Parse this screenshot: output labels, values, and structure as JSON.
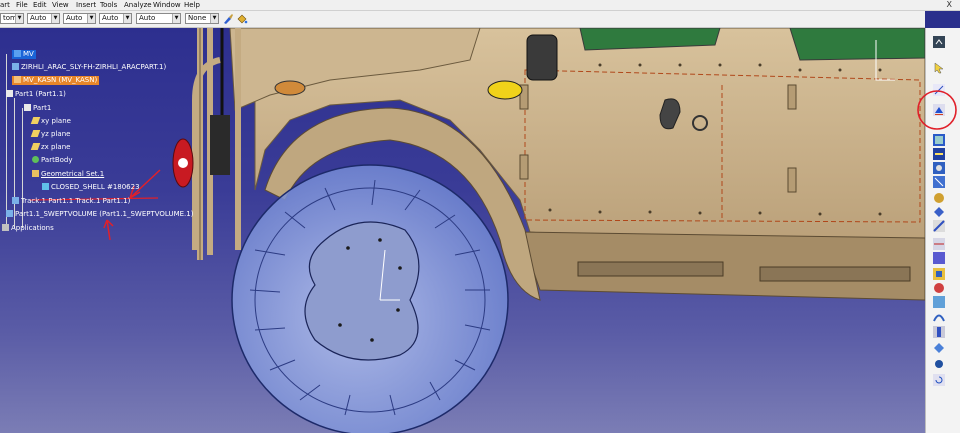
{
  "menubar": {
    "items": [
      "art",
      "File",
      "Edit",
      "View",
      "Insert",
      "Tools",
      "Analyze",
      "Window",
      "Help"
    ],
    "close_symbol": "X"
  },
  "toolbar": {
    "combos": [
      {
        "value": "tomet"
      },
      {
        "value": "Auto"
      },
      {
        "value": "Auto"
      },
      {
        "value": "Auto"
      },
      {
        "value": "Auto"
      },
      {
        "value": "None"
      }
    ],
    "icons": [
      "brush-icon",
      "paint-bucket-icon"
    ]
  },
  "tree": {
    "nodes": [
      {
        "label": "MV",
        "style": "hl",
        "icon": "product-icon"
      },
      {
        "label": "ZIRHLI_ARAC_SLY-FH-ZIRHLI_ARACPART.1)",
        "style": "",
        "icon": "product-icon"
      },
      {
        "label": "MV_KASN (MV_KASN)",
        "style": "orange",
        "icon": "product-icon"
      },
      {
        "label": "Part1 (Part1.1)",
        "style": "",
        "icon": "part-icon"
      },
      {
        "label": "Part1",
        "style": "",
        "icon": "part-icon"
      },
      {
        "label": "xy plane",
        "style": "",
        "icon": "plane-icon"
      },
      {
        "label": "yz plane",
        "style": "",
        "icon": "plane-icon"
      },
      {
        "label": "zx plane",
        "style": "",
        "icon": "plane-icon"
      },
      {
        "label": "PartBody",
        "style": "",
        "icon": "body-icon"
      },
      {
        "label": "Geometrical Set.1",
        "style": "",
        "icon": "geoset-icon"
      },
      {
        "label": "CLOSED_SHELL #180623",
        "style": "",
        "icon": "shell-icon"
      },
      {
        "label": "Track.1 Part1.1 Track.1 Part1.1)",
        "style": "",
        "icon": "product-icon"
      },
      {
        "label": "Part1.1_SWEPTVOLUME (Part1.1_SWEPTVOLUME.1)",
        "style": "",
        "icon": "product-icon"
      },
      {
        "label": "Applications",
        "style": "",
        "icon": "applications-icon"
      }
    ]
  },
  "right_toolbar": {
    "icons": [
      "chevron-up-icon",
      "cursor-icon",
      "sketch-icon",
      "swept-volume-icon",
      "catalog-icon",
      "measure-icon",
      "assembly-icon",
      "constraint-icon",
      "snap-icon",
      "clash-icon",
      "section-icon",
      "distance-icon",
      "publish-icon",
      "analysis-icon",
      "sticky-icon",
      "shell-icon",
      "sweep-icon",
      "tools-icon",
      "manipulate-icon",
      "explode-icon",
      "update-icon"
    ]
  },
  "colors": {
    "viewport_top": "#2d2f8f",
    "vehicle_body": "#c9b28c",
    "tree_highlight": "#1a64d8",
    "tree_orange": "#e7862a",
    "annotation_red": "#e0202a",
    "wheel_blue": "#8fa6e6"
  }
}
